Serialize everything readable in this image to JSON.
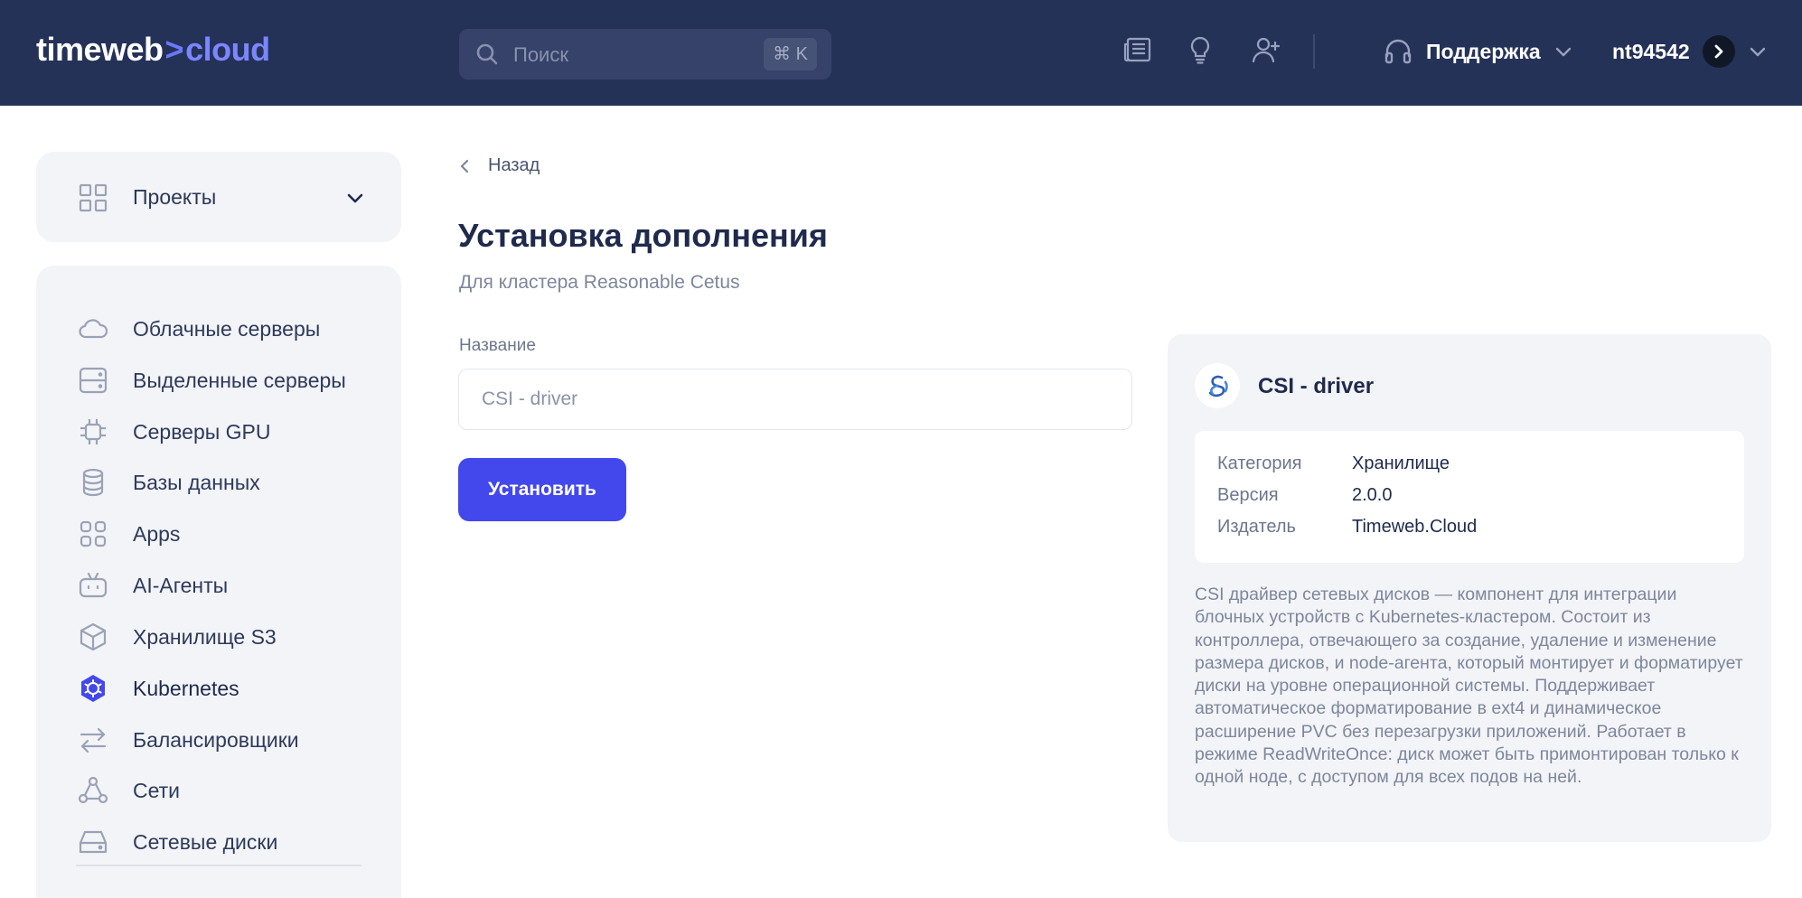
{
  "header": {
    "logo": {
      "part1": "timeweb",
      "separator": ">",
      "part2": "cloud"
    },
    "search": {
      "placeholder": "Поиск",
      "shortcut": "⌘ K"
    },
    "icons": [
      "news-icon",
      "lightbulb-icon",
      "add-user-icon"
    ],
    "support_label": "Поддержка",
    "username": "nt94542"
  },
  "sidebar": {
    "projects_label": "Проекты",
    "items": [
      {
        "label": "Облачные серверы",
        "icon": "cloud-icon",
        "active": false
      },
      {
        "label": "Выделенные серверы",
        "icon": "server-icon",
        "active": false
      },
      {
        "label": "Серверы GPU",
        "icon": "chip-icon",
        "active": false
      },
      {
        "label": "Базы данных",
        "icon": "database-icon",
        "active": false
      },
      {
        "label": "Apps",
        "icon": "apps-icon",
        "active": false
      },
      {
        "label": "AI-Агенты",
        "icon": "robot-icon",
        "active": false
      },
      {
        "label": "Хранилище S3",
        "icon": "box-icon",
        "active": false
      },
      {
        "label": "Kubernetes",
        "icon": "kubernetes-icon",
        "active": true
      },
      {
        "label": "Балансировщики",
        "icon": "balancer-icon",
        "active": false
      },
      {
        "label": "Сети",
        "icon": "network-icon",
        "active": false
      },
      {
        "label": "Сетевые диски",
        "icon": "disk-icon",
        "active": false
      }
    ]
  },
  "main": {
    "back_label": "Назад",
    "title": "Установка дополнения",
    "subtitle": "Для кластера Reasonable Cetus",
    "field_label": "Название",
    "field_value": "CSI - driver",
    "install_label": "Установить"
  },
  "addon": {
    "name": "CSI - driver",
    "props": [
      {
        "key": "Категория",
        "value": "Хранилище"
      },
      {
        "key": "Версия",
        "value": "2.0.0"
      },
      {
        "key": "Издатель",
        "value": "Timeweb.Cloud"
      }
    ],
    "description": "CSI драйвер сетевых дисков — компонент для интеграции блочных устройств с Kubernetes-кластером. Состоит из контроллера, отвечающего за создание, удаление и изменение размера дисков, и node-агента, который монтирует и форматирует диски на уровне операционной системы. Поддерживает автоматическое форматирование в ext4 и динамическое расширение PVC без перезагрузки приложений. Работает в режиме ReadWriteOnce: диск может быть примонтирован только к одной ноде, с доступом для всех подов на ней."
  },
  "colors": {
    "header_bg": "#253258",
    "accent": "#4348ed",
    "logo_accent": "#6b78ff",
    "panel_bg": "#f3f4f7"
  }
}
